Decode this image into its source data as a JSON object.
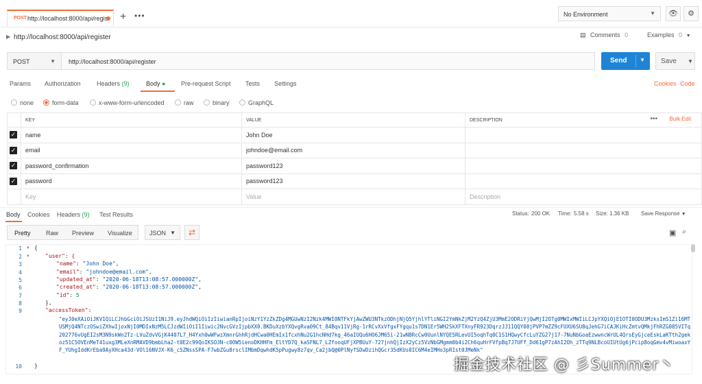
{
  "tab": {
    "method": "POST",
    "url": "http://localhost:8000/api/regis"
  },
  "environment": "No Environment",
  "request": {
    "title": "http://localhost:8000/api/register",
    "comments_label": "Comments",
    "comments_count": "0",
    "examples_label": "Examples",
    "examples_count": "0",
    "method": "POST",
    "url": "http://localhost:8000/api/register",
    "send_label": "Send",
    "save_label": "Save"
  },
  "request_tabs": {
    "params": "Params",
    "authorization": "Authorization",
    "headers": "Headers",
    "headers_count": "(9)",
    "body": "Body",
    "prerequest": "Pre-request Script",
    "tests": "Tests",
    "settings": "Settings",
    "cookies": "Cookies",
    "code": "Code"
  },
  "body_types": [
    "none",
    "form-data",
    "x-www-form-urlencoded",
    "raw",
    "binary",
    "GraphQL"
  ],
  "selected_body_type": "form-data",
  "params_table": {
    "headers": [
      "KEY",
      "VALUE",
      "DESCRIPTION"
    ],
    "bulk_edit": "Bulk Edit",
    "rows": [
      {
        "key": "name",
        "value": "John Doe"
      },
      {
        "key": "email",
        "value": "johndoe@email.com"
      },
      {
        "key": "password_confirmation",
        "value": "password123"
      },
      {
        "key": "password",
        "value": "password123"
      }
    ],
    "placeholder": {
      "key": "Key",
      "value": "Value",
      "description": "Description"
    }
  },
  "response_tabs": {
    "body": "Body",
    "cookies": "Cookies",
    "headers": "Headers",
    "headers_count": "(9)",
    "test_results": "Test Results"
  },
  "response_status": {
    "status_label": "Status:",
    "status_value": "200 OK",
    "time_label": "Time:",
    "time_value": "5.58 s",
    "size_label": "Size:",
    "size_value": "1.36 KB",
    "save_response": "Save Response"
  },
  "format_tabs": [
    "Pretty",
    "Raw",
    "Preview",
    "Visualize"
  ],
  "format_select": "JSON",
  "response_lines": {
    "l1": "{",
    "l2": "\"user\": {",
    "l3k": "\"name\"",
    "l3v": "\"John Doe\"",
    "l4k": "\"email\"",
    "l4v": "\"johndoe@email.com\"",
    "l5k": "\"updated_at\"",
    "l5v": "\"2020-06-18T13:08:57.000000Z\"",
    "l6k": "\"created_at\"",
    "l6v": "\"2020-06-18T13:08:57.000000Z\"",
    "l7k": "\"id\"",
    "l7v": "5",
    "l8": "},",
    "l9k": "\"accessToken\"",
    "token": "\"eyJ0eXAiOiJKV1QiLCJhbGciOiJSUzI1NiJ9.eyJhdWQiOiIzIiwianRpIjoiNzY1YzZkZDg4MGUwNzI2Nzk4MWI0NTFkYjAwZWU3NTkzODhjNjQ5YjhlYTliNGI2YmNkZjM2YzQ4ZjU3MmE2ODRiYjQwMjI2OTg0MWIxMWIiLCJpYXQiOjE1OTI0ODU3MzksImS1Zi16MTUSMjQ4NTczOSwiZXhwIjoxNjI0MDIxNzM5LCJzdWIiOiI1Iiwic2NvcGVzIjpbXX0.BKDuXzbYXQvgRva09Ct_84Bqv11VjRg-1rRCvXxVfgxFYgqu1s7DN1Er5WH2SkXFTXnyFR923DqrzJJ11QQY08jPVP7mZZ9cFUXU6SU8qJehG7iCAJKiHcZmtvQMkjFhRZG085VITq202776vUgEI2sM3N9skWn2Tz-LVuZdvVGjK4407L7_H4Yxh0wWFwzXmnrGhhRjdHCwa0HEmIx1fcxhNu2G1hcNHd7kg_46aIUQu6HO6JM65i-21wN8RcCw0UunlNYQE5RLevUI5oqhTq0C1S1HQwyCfcLuYZG27j17-7NuNbGoaEzwwncWrUL4QrsEyGjceEskLaKTth2gekoz51C5OVEnMeT41uxg3MLeXnRMAVD9bmbLha2-t0E2c99QoIKSOJN-c0OW5ienoDKHHFm_EltYD7Q_kaSFNL7_LZfooqUFjXPBUuY-727jnhQjIzX2yCz5VzNbGMgmm0b4i2Ch6quHrFVfpBq7J7UFf_Dd61gP7zAhI2Oh_zTTq9NLBcoUIUtUg6jPcip8oqGmv4vMiwoaxYF_YUhgIddKrEba9AyXHca43d-VOl16NVJX-K6_c5ZNssSPA-F7wbZGu8rsclIMbmDqwhdK5pPugwy8z7qv_Ca2jbQ@0PlNyfSDwDzihQGcr35dKUs0IC6M4eIMHo3pR1st0JMeNk\"",
    "l10": "}"
  },
  "watermark": "掘金技术社区 @ 彡Summer丶"
}
